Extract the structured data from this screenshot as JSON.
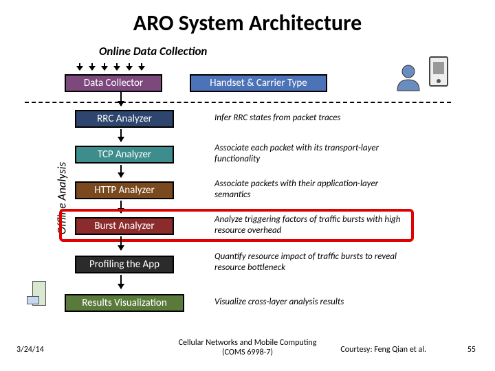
{
  "title": "ARO System Architecture",
  "sections": {
    "online": "Online Data Collection",
    "offline": "Offline Analysis"
  },
  "boxes": {
    "data_collector": "Data Collector",
    "handset_carrier": "Handset & Carrier Type",
    "rrc": "RRC Analyzer",
    "tcp": "TCP Analyzer",
    "http": "HTTP Analyzer",
    "burst": "Burst Analyzer",
    "profiling": "Profiling the App",
    "results": "Results Visualization"
  },
  "desc": {
    "rrc": "Infer RRC states from packet traces",
    "tcp": "Associate each packet with its transport-layer functionality",
    "http": "Associate packets with their application-layer semantics",
    "burst": "Analyze triggering factors of traffic bursts with high resource overhead",
    "profiling": "Quantify resource impact of traffic bursts to reveal resource bottleneck",
    "results": "Visualize cross-layer analysis results"
  },
  "footer": {
    "date": "3/24/14",
    "center_l1": "Cellular Networks and Mobile Computing",
    "center_l2": "(COMS 6998-7)",
    "courtesy": "Courtesy: Feng Qian et al.",
    "page": "55"
  }
}
